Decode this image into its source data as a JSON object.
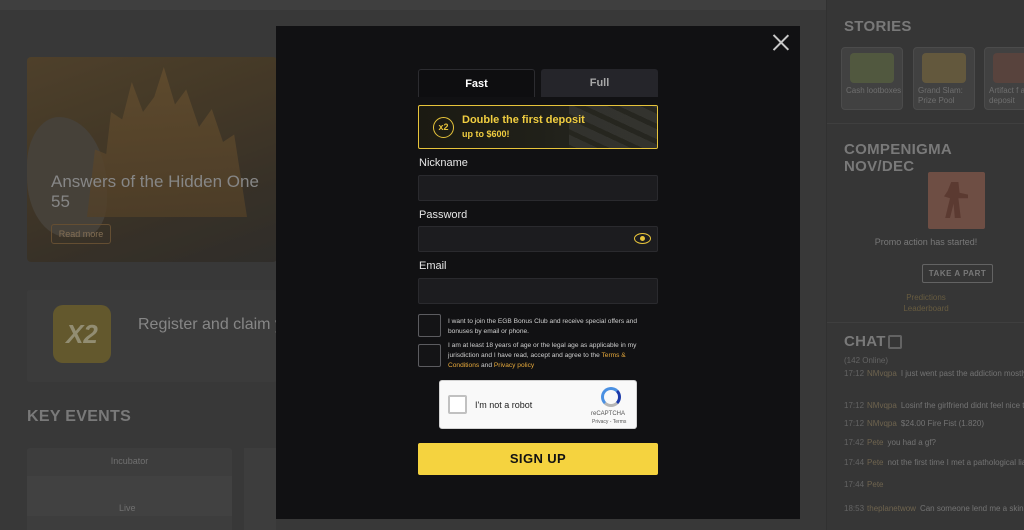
{
  "background": {
    "hero": {
      "title": "Answers of the Hidden One 55",
      "button": "Read more"
    },
    "promo": {
      "text": "Register and claim your first deposit",
      "badge": "X2"
    },
    "key_events": {
      "title": "KEY EVENTS",
      "card_subtitle": "Incubator",
      "live": "Live"
    }
  },
  "sidebar": {
    "stories_title": "STORIES",
    "stories": [
      {
        "label": "Cash lootboxes"
      },
      {
        "label": "Grand Slam: Prize Pool"
      },
      {
        "label": "Artifact f a deposit"
      }
    ],
    "compenigma_title": "COMPENIGMA NOV/DEC",
    "promo_started": "Promo action has started!",
    "take_part": "TAKE A PART",
    "predictions": "Predictions",
    "leaderboard": "Leaderboard",
    "chat_title": "CHAT",
    "chat_online": "(142 Online)",
    "chat_lines": [
      {
        "time": "17:12",
        "user": "NMvqpa",
        "text": "I just went past the addiction mostly, girlfriend, own apartment..."
      },
      {
        "time": "17:12",
        "user": "NMvqpa",
        "text": "Losinf the girlfriend didnt feel nice th"
      },
      {
        "time": "17:12",
        "user": "NMvqpa",
        "text": "$24.00 Fire Fist (1.820)"
      },
      {
        "time": "17:42",
        "user": "Pete",
        "text": "you had a gf?"
      },
      {
        "time": "17:44",
        "user": "Pete",
        "text": "not the first time I met a pathological liar"
      },
      {
        "time": "17:44",
        "user": "Pete",
        "text": ""
      },
      {
        "time": "18:53",
        "user": "theplanetwow",
        "text": "Can someone lend me a skin? Pls"
      }
    ]
  },
  "modal": {
    "tabs": {
      "fast": "Fast",
      "full": "Full"
    },
    "bonus": {
      "badge": "x2",
      "title": "Double the first deposit",
      "subtitle": "up to $600!"
    },
    "fields": {
      "nickname_label": "Nickname",
      "password_label": "Password",
      "email_label": "Email"
    },
    "checkbox_bonus_club": "I want to join the EGB Bonus Club and receive special offers and bonuses by email or phone.",
    "checkbox_age": {
      "prefix": "I am at least 18 years of age or the legal age as applicable in my jurisdiction and I have read, accept and agree to the",
      "terms_link": "Terms & Conditions",
      "and": "and",
      "privacy_link": "Privacy policy"
    },
    "recaptcha": {
      "label": "I'm not a robot",
      "brand": "reCAPTCHA",
      "links": "Privacy - Terms"
    },
    "signup_button": "SIGN UP"
  },
  "colors": {
    "accent": "#f5d33f",
    "modal_bg": "#111113",
    "link": "#e7a93b"
  }
}
